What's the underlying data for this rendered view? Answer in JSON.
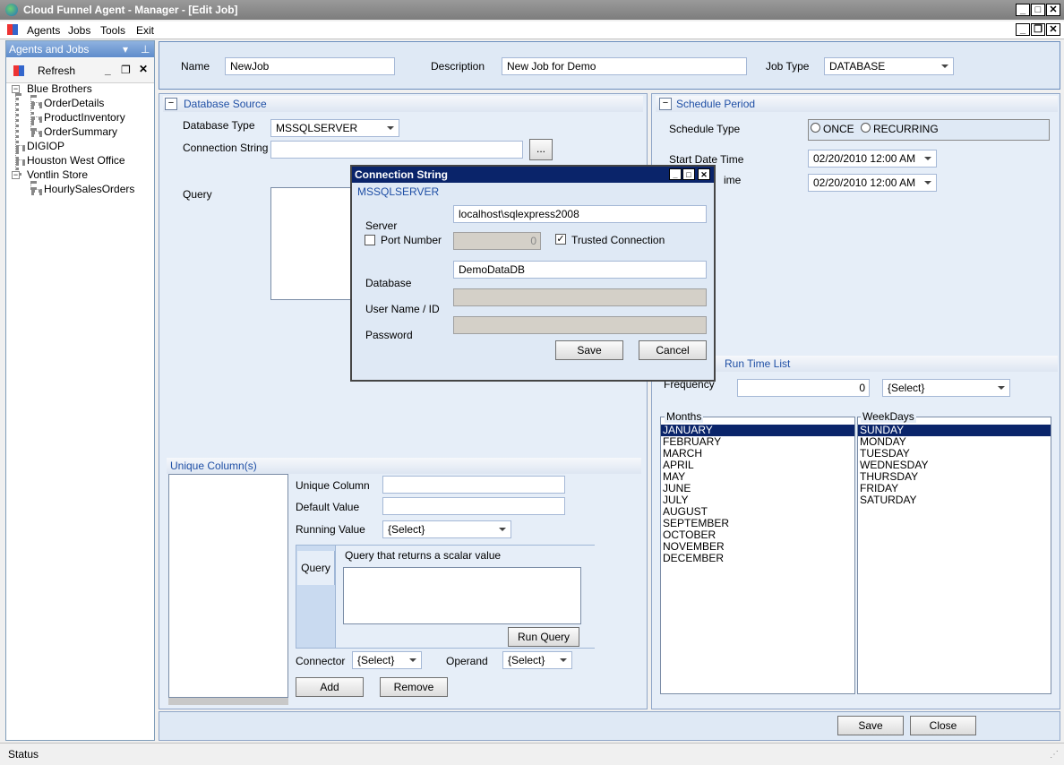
{
  "window": {
    "title": "Cloud Funnel Agent - Manager - [Edit Job]"
  },
  "menu": {
    "items": [
      "Agents",
      "Jobs",
      "Tools",
      "Exit"
    ]
  },
  "left_panel": {
    "title": "Agents and Jobs",
    "pin_icon": "pin-icon",
    "refresh_label": "Refresh",
    "tree": [
      {
        "label": "Blue Brothers",
        "children": [
          "OrderDetails",
          "ProductInventory",
          "OrderSummary"
        ]
      },
      {
        "label": "DIGIOP"
      },
      {
        "label": "Houston West Office"
      },
      {
        "label": "Vontlin Store",
        "children": [
          "HourlySalesOrders"
        ]
      }
    ]
  },
  "job": {
    "name_label": "Name",
    "name_value": "NewJob",
    "desc_label": "Description",
    "desc_value": "New Job for Demo",
    "type_label": "Job Type",
    "type_value": "DATABASE"
  },
  "db_source": {
    "title": "Database Source",
    "db_type_label": "Database Type",
    "db_type_value": "MSSQLSERVER",
    "conn_label": "Connection String",
    "conn_value": "",
    "browse_label": "...",
    "query_label": "Query"
  },
  "unique_columns": {
    "title": "Unique Column(s)",
    "col_label": "Unique Column",
    "default_label": "Default Value",
    "running_label": "Running Value",
    "running_value": "{Select}",
    "query_tab": "Query",
    "query_caption": "Query that returns a scalar value",
    "run_query": "Run Query",
    "connector_label": "Connector",
    "connector_value": "{Select}",
    "operand_label": "Operand",
    "operand_value": "{Select}",
    "add": "Add",
    "remove": "Remove"
  },
  "schedule": {
    "title": "Schedule Period",
    "type_label": "Schedule Type",
    "once": "ONCE",
    "recurring": "RECURRING",
    "start_label": "Start Date Time",
    "start_value": "02/20/2010 12:00 AM",
    "end_label_visible": "ime",
    "end_value": "02/20/2010 12:00 AM",
    "runtime_title": "Run Time List",
    "freq_label": "Frequency",
    "freq_value": "0",
    "freq_select": "{Select}",
    "months_label": "Months",
    "months": [
      "JANUARY",
      "FEBRUARY",
      "MARCH",
      "APRIL",
      "MAY",
      "JUNE",
      "JULY",
      "AUGUST",
      "SEPTEMBER",
      "OCTOBER",
      "NOVEMBER",
      "DECEMBER"
    ],
    "weekdays_label": "WeekDays",
    "weekdays": [
      "SUNDAY",
      "MONDAY",
      "TUESDAY",
      "WEDNESDAY",
      "THURSDAY",
      "FRIDAY",
      "SATURDAY"
    ]
  },
  "dialog": {
    "title": "Connection String",
    "subtitle": "MSSQLSERVER",
    "server_label": "Server",
    "server_value": "localhost\\sqlexpress2008",
    "port_label": "Port Number",
    "port_value": "0",
    "trusted_label": "Trusted Connection",
    "db_label": "Database",
    "db_value": "DemoDataDB",
    "user_label": "User Name / ID",
    "pass_label": "Password",
    "save": "Save",
    "cancel": "Cancel"
  },
  "footer": {
    "save": "Save",
    "close": "Close"
  },
  "status": {
    "text": "Status"
  }
}
